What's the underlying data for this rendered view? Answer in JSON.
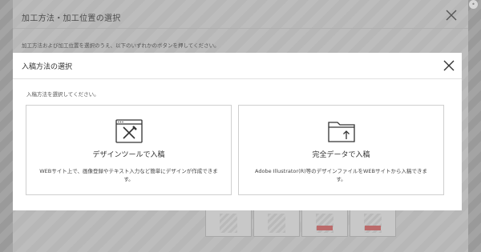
{
  "outer_dialog": {
    "title": "加工方法・加工位置の選択",
    "instruction": "加工方法および加工位置を選択のうえ、以下のいずれかのボタンを押してください。"
  },
  "modal": {
    "title": "入稿方法の選択",
    "instruction": "入稿方法を選択してください。",
    "options": [
      {
        "icon": "design-tool-icon",
        "title": "デザインツールで入稿",
        "description": "WEBサイト上で、画像登録やテキスト入力など簡単にデザインが作成できます。"
      },
      {
        "icon": "folder-upload-icon",
        "title": "完全データで入稿",
        "description": "Adobe Illustrator(R)等のデザインファイルをWEBサイトから入稿できます。"
      }
    ]
  },
  "colors": {
    "overlay": "#9a9a9a",
    "modal_bg": "#ffffff",
    "border": "#cfcfcf",
    "text": "#333333",
    "thumb_mark": "#bb6b6b"
  }
}
